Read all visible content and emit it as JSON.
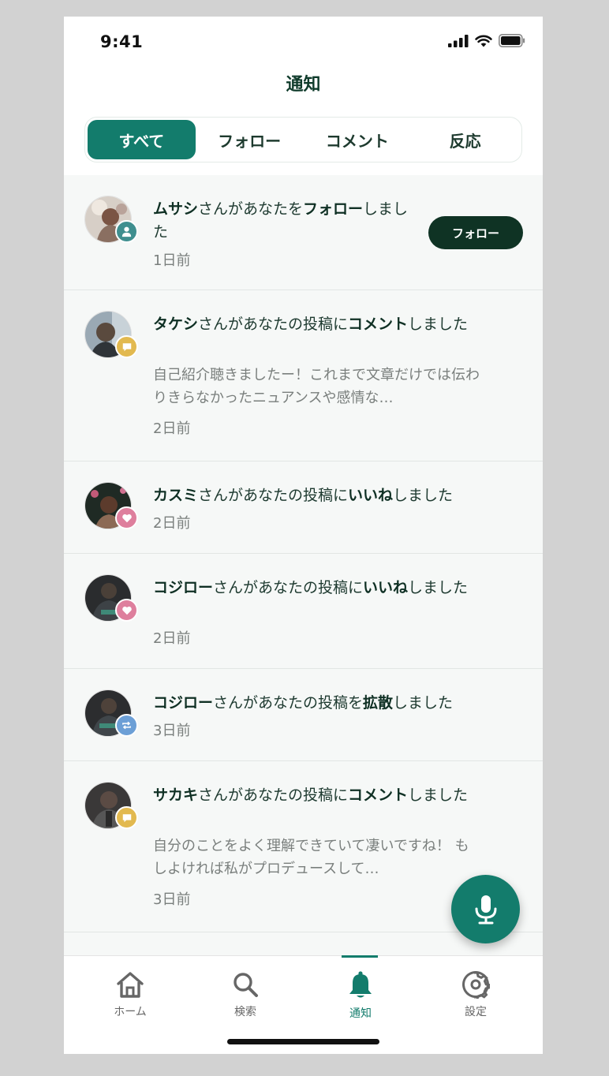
{
  "status": {
    "time": "9:41"
  },
  "header": {
    "title": "通知"
  },
  "segments": [
    {
      "label": "すべて",
      "active": true
    },
    {
      "label": "フォロー",
      "active": false
    },
    {
      "label": "コメント",
      "active": false
    },
    {
      "label": "反応",
      "active": false
    }
  ],
  "notifications": [
    {
      "name": "ムサシ",
      "mid": "さんがあなたを",
      "action": "フォロー",
      "end": "しました",
      "type": "follow",
      "badge_icon": "person-icon",
      "badge_color": "#3f8f8f",
      "time": "1日前",
      "button": "フォロー"
    },
    {
      "name": "タケシ",
      "mid": "さんがあなたの投稿に",
      "action": "コメント",
      "end": "しました",
      "type": "comment",
      "badge_icon": "comment-icon",
      "badge_color": "#e2b94f",
      "preview": "自己紹介聴きましたー！これまで文章だけでは伝わりきらなかったニュアンスや感情な…",
      "time": "2日前"
    },
    {
      "name": "カスミ",
      "mid": "さんがあなたの投稿に",
      "action": "いいね",
      "end": "しました",
      "type": "like",
      "badge_icon": "heart-icon",
      "badge_color": "#de7f9d",
      "time": "2日前"
    },
    {
      "name": "コジロー",
      "mid": "さんがあなたの投稿に",
      "action": "いいね",
      "end": "しました",
      "type": "like",
      "badge_icon": "heart-icon",
      "badge_color": "#de7f9d",
      "time": "2日前"
    },
    {
      "name": "コジロー",
      "mid": "さんがあなたの投稿を",
      "action": "拡散",
      "end": "しました",
      "type": "share",
      "badge_icon": "repost-icon",
      "badge_color": "#6c9fd6",
      "time": "3日前"
    },
    {
      "name": "サカキ",
      "mid": "さんがあなたの投稿に",
      "action": "コメント",
      "end": "しました",
      "type": "comment",
      "badge_icon": "comment-icon",
      "badge_color": "#e2b94f",
      "preview": "自分のことをよく理解できていて凄いですね！ もしよければ私がプロデュースして…",
      "time": "3日前"
    }
  ],
  "fab": {
    "icon": "microphone-icon"
  },
  "tabbar": [
    {
      "label": "ホーム",
      "icon": "home-icon",
      "active": false
    },
    {
      "label": "検索",
      "icon": "search-icon",
      "active": false
    },
    {
      "label": "通知",
      "icon": "bell-icon",
      "active": true
    },
    {
      "label": "設定",
      "icon": "gear-icon",
      "active": false
    }
  ],
  "colors": {
    "accent": "#137c6c",
    "dark": "#0f3324",
    "item_bg": "#f6f8f7"
  }
}
